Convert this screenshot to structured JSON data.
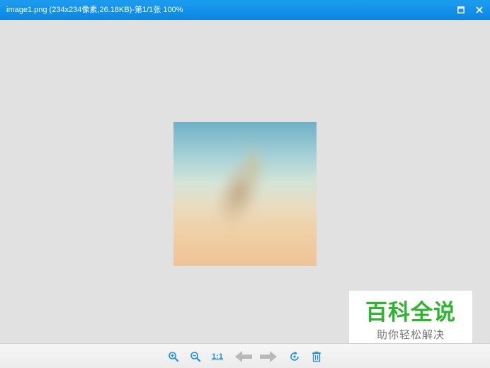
{
  "window": {
    "title": "image1.png (234x234像素,26.18KB)-第1/1张 100%",
    "accent_color": "#0a86e4"
  },
  "toolbar": {
    "zoom_in_icon": "zoom-in-icon",
    "zoom_out_icon": "zoom-out-icon",
    "actual_size_label": "1:1",
    "prev_icon": "arrow-left-icon",
    "next_icon": "arrow-right-icon",
    "rotate_icon": "rotate-icon",
    "delete_icon": "trash-icon"
  },
  "watermark": {
    "main": "百科全说",
    "sub": "助你轻松解决",
    "color": "#2db52d"
  }
}
